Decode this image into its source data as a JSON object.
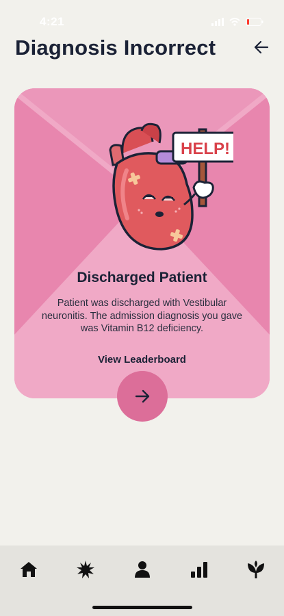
{
  "status_bar": {
    "time": "4:21"
  },
  "header": {
    "title": "Diagnosis Incorrect",
    "back_icon": "arrow-left-icon"
  },
  "card": {
    "sign_text": "HELP!",
    "title": "Discharged Patient",
    "message": "Patient was discharged with Vestibular neuronitis. The admission diagnosis you gave was Vitamin B12 deficiency.",
    "leaderboard_label": "View Leaderboard",
    "next_icon": "arrow-right-icon"
  },
  "tab_bar": {
    "tabs": [
      {
        "icon": "home-icon"
      },
      {
        "icon": "starburst-icon"
      },
      {
        "icon": "person-icon"
      },
      {
        "icon": "bar-chart-icon"
      },
      {
        "icon": "sprout-icon"
      }
    ]
  },
  "colors": {
    "background": "#f2f1ec",
    "card": "#f0a9c6",
    "card_stripe": "#e886ae",
    "accent_button": "#dc6e99",
    "heart": "#e05a5e",
    "text_primary": "#1b2236",
    "tab_bar": "#e4e3de"
  }
}
